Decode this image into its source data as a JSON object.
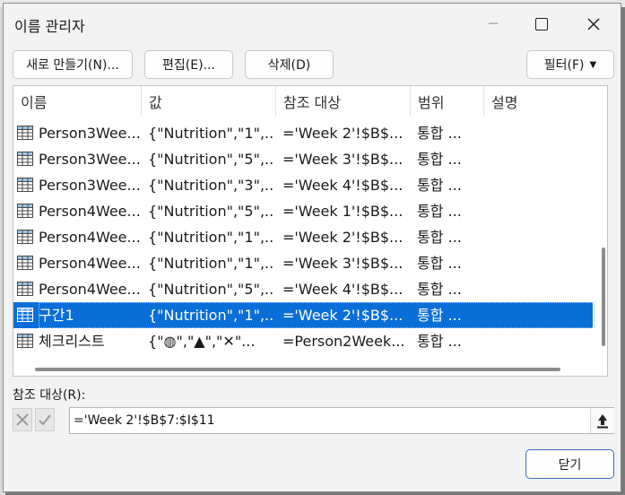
{
  "dialog": {
    "title": "이름 관리자",
    "buttons": {
      "new": "새로 만들기(N)...",
      "edit": "편집(E)...",
      "delete": "삭제(D)",
      "filter": "필터(F)",
      "close": "닫기"
    }
  },
  "list": {
    "columns": [
      "이름",
      "값",
      "참조 대상",
      "범위",
      "설명"
    ],
    "rows": [
      {
        "name": "Person3Wee...",
        "value": "{\"Nutrition\",\"1\",...",
        "ref": "='Week 2'!$B$...",
        "scope": "통합 ..."
      },
      {
        "name": "Person3Wee...",
        "value": "{\"Nutrition\",\"5\",...",
        "ref": "='Week 3'!$B$...",
        "scope": "통합 ..."
      },
      {
        "name": "Person3Wee...",
        "value": "{\"Nutrition\",\"3\",...",
        "ref": "='Week 4'!$B$...",
        "scope": "통합 ..."
      },
      {
        "name": "Person4Wee...",
        "value": "{\"Nutrition\",\"5\",...",
        "ref": "='Week 1'!$B$...",
        "scope": "통합 ..."
      },
      {
        "name": "Person4Wee...",
        "value": "{\"Nutrition\",\"1\",...",
        "ref": "='Week 2'!$B$...",
        "scope": "통합 ..."
      },
      {
        "name": "Person4Wee...",
        "value": "{\"Nutrition\",\"1\",...",
        "ref": "='Week 3'!$B$...",
        "scope": "통합 ..."
      },
      {
        "name": "Person4Wee...",
        "value": "{\"Nutrition\",\"5\",...",
        "ref": "='Week 4'!$B$...",
        "scope": "통합 ..."
      },
      {
        "name": "구간1",
        "value": "{\"Nutrition\",\"1\",...",
        "ref": "='Week 2'!$B$...",
        "scope": "통합 ...",
        "selected": true
      },
      {
        "name": "체크리스트",
        "value": "{\"◍\",\"▲\",\"✕\"...",
        "ref": "=Person2Week...",
        "scope": "통합 ..."
      }
    ]
  },
  "reference": {
    "label": "참조 대상(R):",
    "value": "='Week 2'!$B$7:$I$11"
  },
  "colors": {
    "selection": "#0a6ed8",
    "accent_border": "#3b6fb6"
  },
  "icons": {
    "row": "table-icon",
    "close": "close-icon",
    "maximize": "maximize-icon",
    "minimize": "minimize-icon",
    "cancel": "cancel-x-icon",
    "confirm": "check-icon",
    "collapse": "collapse-dialog-icon",
    "dropdown": "chevron-down-icon"
  }
}
